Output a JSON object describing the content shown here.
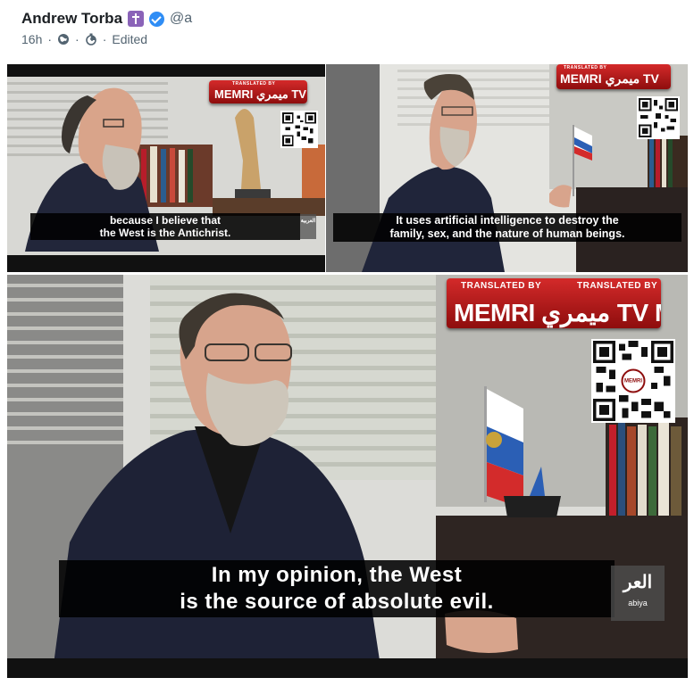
{
  "post": {
    "author_name": "Andrew Torba",
    "handle": "@a",
    "time": "16h",
    "edited_label": "Edited",
    "separator": "·"
  },
  "icons": {
    "badge": "cross-badge-icon",
    "verified": "verified-icon",
    "visibility": "globe-icon",
    "expiry": "timer-icon"
  },
  "media": {
    "frames": [
      {
        "subtitle_line1": "because I believe that",
        "subtitle_line2": "the West is the Antichrist.",
        "sign_top": "TRANSLATED BY",
        "sign_main": "MEMRI ميمري TV",
        "logo": "العربية"
      },
      {
        "subtitle_line1": "It uses artificial intelligence to destroy the",
        "subtitle_line2": "family, sex, and the nature of human beings.",
        "sign_top": "TRANSLATED BY",
        "sign_main": "MEMRI ميمري TV"
      },
      {
        "subtitle_line1": "In my opinion, the West",
        "subtitle_line2": "is the source of absolute evil.",
        "sign_top_left": "TRANSLATED BY",
        "sign_top_right": "TRANSLATED BY",
        "sign_main": "MEMRI ميمري TV MEMRI ميمري TV",
        "qr_label": "MEMRI",
        "logo": "العر",
        "logo_sub": "abiya"
      }
    ]
  },
  "colors": {
    "verified_blue": "#2f8df5",
    "badge_purple": "#8a63b8",
    "memri_red": "#c41e1e",
    "meta_gray": "#536471"
  }
}
